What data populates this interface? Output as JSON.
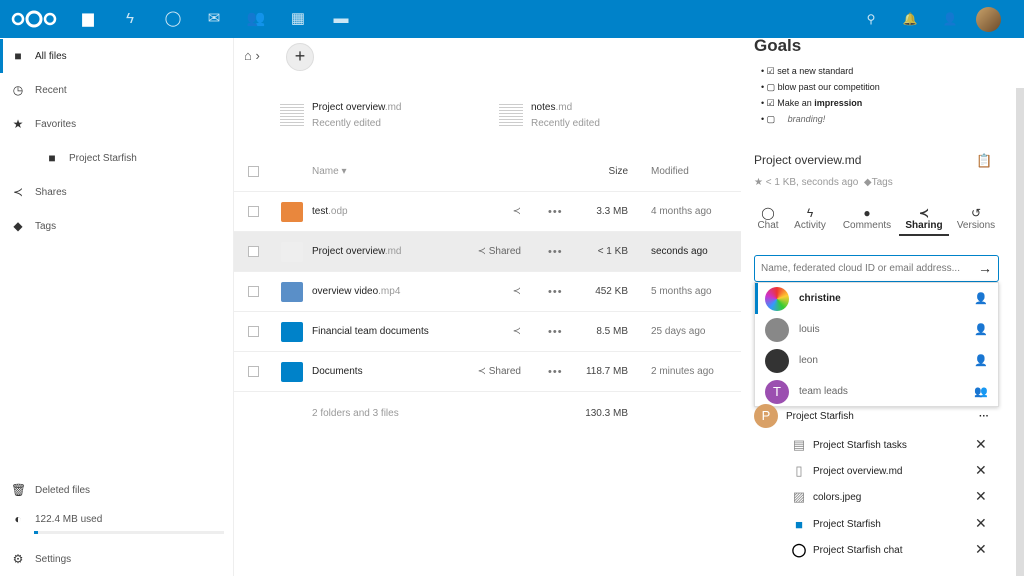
{
  "topbar": {
    "apps": [
      "files-icon",
      "activity-icon",
      "talk-icon",
      "mail-icon",
      "contacts-icon",
      "calendar-icon",
      "deck-icon"
    ],
    "right": [
      "search-icon",
      "notifications-icon",
      "contacts-menu-icon"
    ]
  },
  "sidebar": {
    "items": [
      {
        "label": "All files",
        "icon": "folder-icon"
      },
      {
        "label": "Recent",
        "icon": "clock-icon"
      },
      {
        "label": "Favorites",
        "icon": "star-icon"
      },
      {
        "label": "Project Starfish",
        "icon": "folder-icon"
      },
      {
        "label": "Shares",
        "icon": "share-icon"
      },
      {
        "label": "Tags",
        "icon": "tag-icon"
      }
    ],
    "deleted": "Deleted files",
    "quota": "122.4 MB used",
    "quota_fraction": 0.02,
    "settings": "Settings"
  },
  "recent": [
    {
      "name": "Project overview",
      "ext": ".md",
      "sub": "Recently edited"
    },
    {
      "name": "notes",
      "ext": ".md",
      "sub": "Recently edited"
    }
  ],
  "table": {
    "headers": {
      "name": "Name",
      "size": "Size",
      "modified": "Modified"
    },
    "rows": [
      {
        "name": "test",
        "ext": ".odp",
        "share": "",
        "size": "3.3 MB",
        "modified": "4 months ago",
        "color": "#e9873d"
      },
      {
        "name": "Project overview",
        "ext": ".md",
        "share": "Shared",
        "size": "< 1 KB",
        "modified": "seconds ago",
        "color": "#eee"
      },
      {
        "name": "overview video",
        "ext": ".mp4",
        "share": "",
        "size": "452 KB",
        "modified": "5 months ago",
        "color": "#5a8fc8"
      },
      {
        "name": "Financial team documents",
        "ext": "",
        "share": "",
        "size": "8.5 MB",
        "modified": "25 days ago",
        "color": "#0082c9"
      },
      {
        "name": "Documents",
        "ext": "",
        "share": "Shared",
        "size": "118.7 MB",
        "modified": "2 minutes ago",
        "color": "#0082c9"
      }
    ],
    "summary": "2 folders and 3 files",
    "total": "130.3 MB"
  },
  "preview": {
    "heading": "Goals",
    "items": [
      {
        "text": "set a new standard",
        "checked": true
      },
      {
        "text": "blow past our competition",
        "checked": false
      },
      {
        "text": "Make an ",
        "bold": "impression",
        "checked": true
      },
      {
        "text": "branding!",
        "checked": false
      }
    ]
  },
  "details": {
    "title": "Project overview.md",
    "meta": "< 1 KB, seconds ago",
    "tags": "Tags",
    "tabs": [
      "Chat",
      "Activity",
      "Comments",
      "Sharing",
      "Versions"
    ],
    "share_placeholder": "Name, federated cloud ID or email address...",
    "suggestions": [
      {
        "name": "christine",
        "color": "#8a3a9a"
      },
      {
        "name": "louis",
        "color": "#555"
      },
      {
        "name": "leon",
        "color": "#333"
      },
      {
        "name": "team leads",
        "color": "#9b4fb0",
        "initial": "T"
      }
    ],
    "circle": {
      "name": "Project Starfish",
      "initial": "P",
      "color": "#d9a066"
    },
    "resources": [
      "Project Starfish tasks",
      "Project overview.md",
      "colors.jpeg",
      "Project Starfish",
      "Project Starfish chat"
    ]
  }
}
